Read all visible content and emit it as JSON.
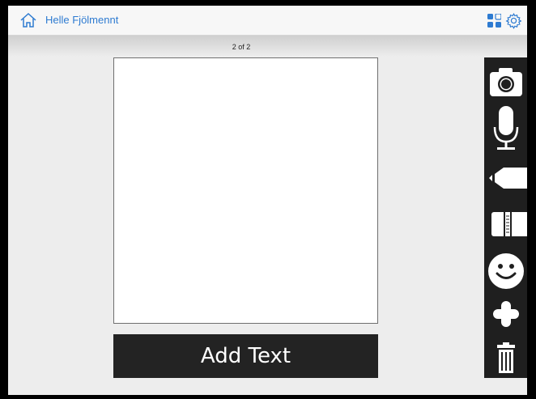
{
  "header": {
    "user_name": "Helle Fjölmennt",
    "icons": [
      "home-icon",
      "grid-icon",
      "gear-icon"
    ]
  },
  "page": {
    "counter": "2 of 2"
  },
  "canvas": {
    "add_text_label": "Add Text"
  },
  "toolbar": {
    "tools": [
      "camera-icon",
      "microphone-icon",
      "pencil-icon",
      "eraser-icon",
      "smiley-icon",
      "plus-icon",
      "trash-icon"
    ]
  },
  "colors": {
    "accent": "#2e7bd1",
    "toolbar_bg": "#1f1f1f",
    "button_bg": "#232323",
    "page_bg": "#ededed"
  }
}
